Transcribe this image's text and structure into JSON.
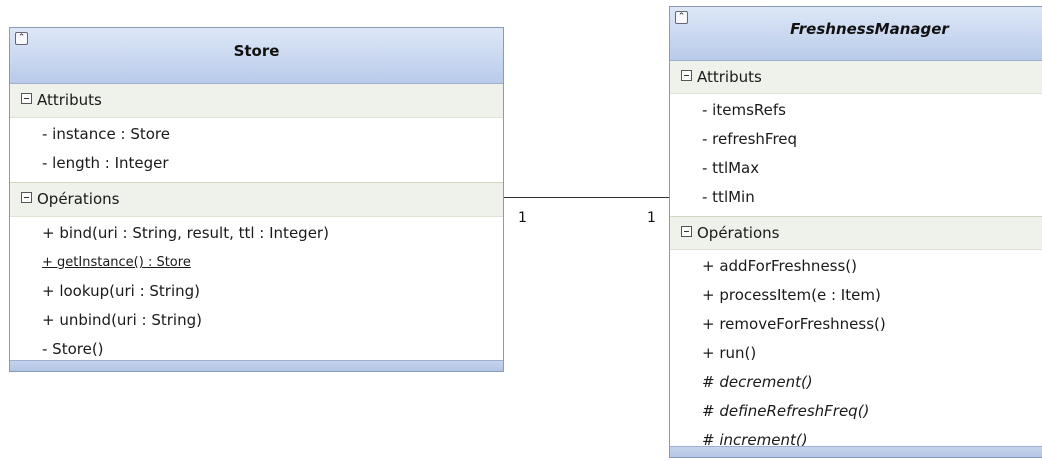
{
  "association": {
    "mult_left": "1",
    "mult_right": "1"
  },
  "store": {
    "name": "Store",
    "attributes_label": "Attributs",
    "attributes": [
      "- instance : Store",
      "- length : Integer"
    ],
    "operations_label": "Opérations",
    "operations": [
      "+ bind(uri : String, result, ttl : Integer)",
      "+ getInstance() : Store",
      "+ lookup(uri : String)",
      "+ unbind(uri : String)",
      "- Store()"
    ]
  },
  "freshness_manager": {
    "name": "FreshnessManager",
    "attributes_label": "Attributs",
    "attributes": [
      "- itemsRefs",
      "- refreshFreq",
      "- ttlMax",
      "- ttlMin"
    ],
    "operations_label": "Opérations",
    "operations": [
      "+ addForFreshness()",
      "+ processItem(e : Item)",
      "+ removeForFreshness()",
      "+ run()",
      "# decrement()",
      "# defineRefreshFreq()",
      "# increment()"
    ]
  },
  "icons": {
    "collapse": "double-chevron-up-icon",
    "section_toggle": "minus-box-icon"
  }
}
